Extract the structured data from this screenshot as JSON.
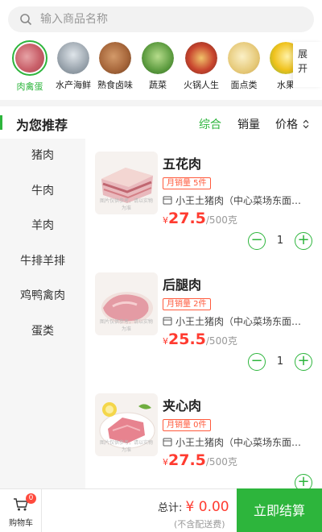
{
  "search": {
    "placeholder": "输入商品名称"
  },
  "categories": [
    {
      "label": "肉禽蛋",
      "selected": true,
      "color": "#c9606a"
    },
    {
      "label": "水产海鲜",
      "selected": false,
      "color": "#9aa4ad"
    },
    {
      "label": "熟食卤味",
      "selected": false,
      "color": "#a8683c"
    },
    {
      "label": "蔬菜",
      "selected": false,
      "color": "#5c9b3f"
    },
    {
      "label": "火锅人生",
      "selected": false,
      "color": "#c8452e"
    },
    {
      "label": "面点类",
      "selected": false,
      "color": "#e6c979"
    },
    {
      "label": "水果",
      "selected": false,
      "color": "#f0c21c"
    }
  ],
  "expand_label": "展开",
  "recommend": {
    "title": "为您推荐",
    "sort": {
      "general": "综合",
      "sales": "销量",
      "price": "价格"
    }
  },
  "leftnav": [
    "猪肉",
    "牛肉",
    "羊肉",
    "牛排羊排",
    "鸡鸭禽肉",
    "蛋类"
  ],
  "products": [
    {
      "name": "五花肉",
      "sales": "月销量 5件",
      "shop": "小王土猪肉（中心菜场东面…",
      "currency": "¥",
      "price": "27.5",
      "unit": "/500克",
      "qty": "1",
      "watermark": "图片仅供参考，请以实物为准"
    },
    {
      "name": "后腿肉",
      "sales": "月销量 2件",
      "shop": "小王土猪肉（中心菜场东面…",
      "currency": "¥",
      "price": "25.5",
      "unit": "/500克",
      "qty": "1",
      "watermark": "图片仅供参考，请以实物为准"
    },
    {
      "name": "夹心肉",
      "sales": "月销量 0件",
      "shop": "小王土猪肉（中心菜场东面…",
      "currency": "¥",
      "price": "27.5",
      "unit": "/500克",
      "qty": "",
      "watermark": "图片仅供参考，请以实物为准"
    }
  ],
  "bottom": {
    "cart_label": "购物车",
    "cart_badge": "0",
    "total_label": "总计:",
    "total_amount": "¥ 0.00",
    "delivery_note": "(不含配送费)",
    "checkout_label": "立即结算"
  },
  "colors": {
    "accent": "#2db53c",
    "price": "#ff3b30"
  }
}
